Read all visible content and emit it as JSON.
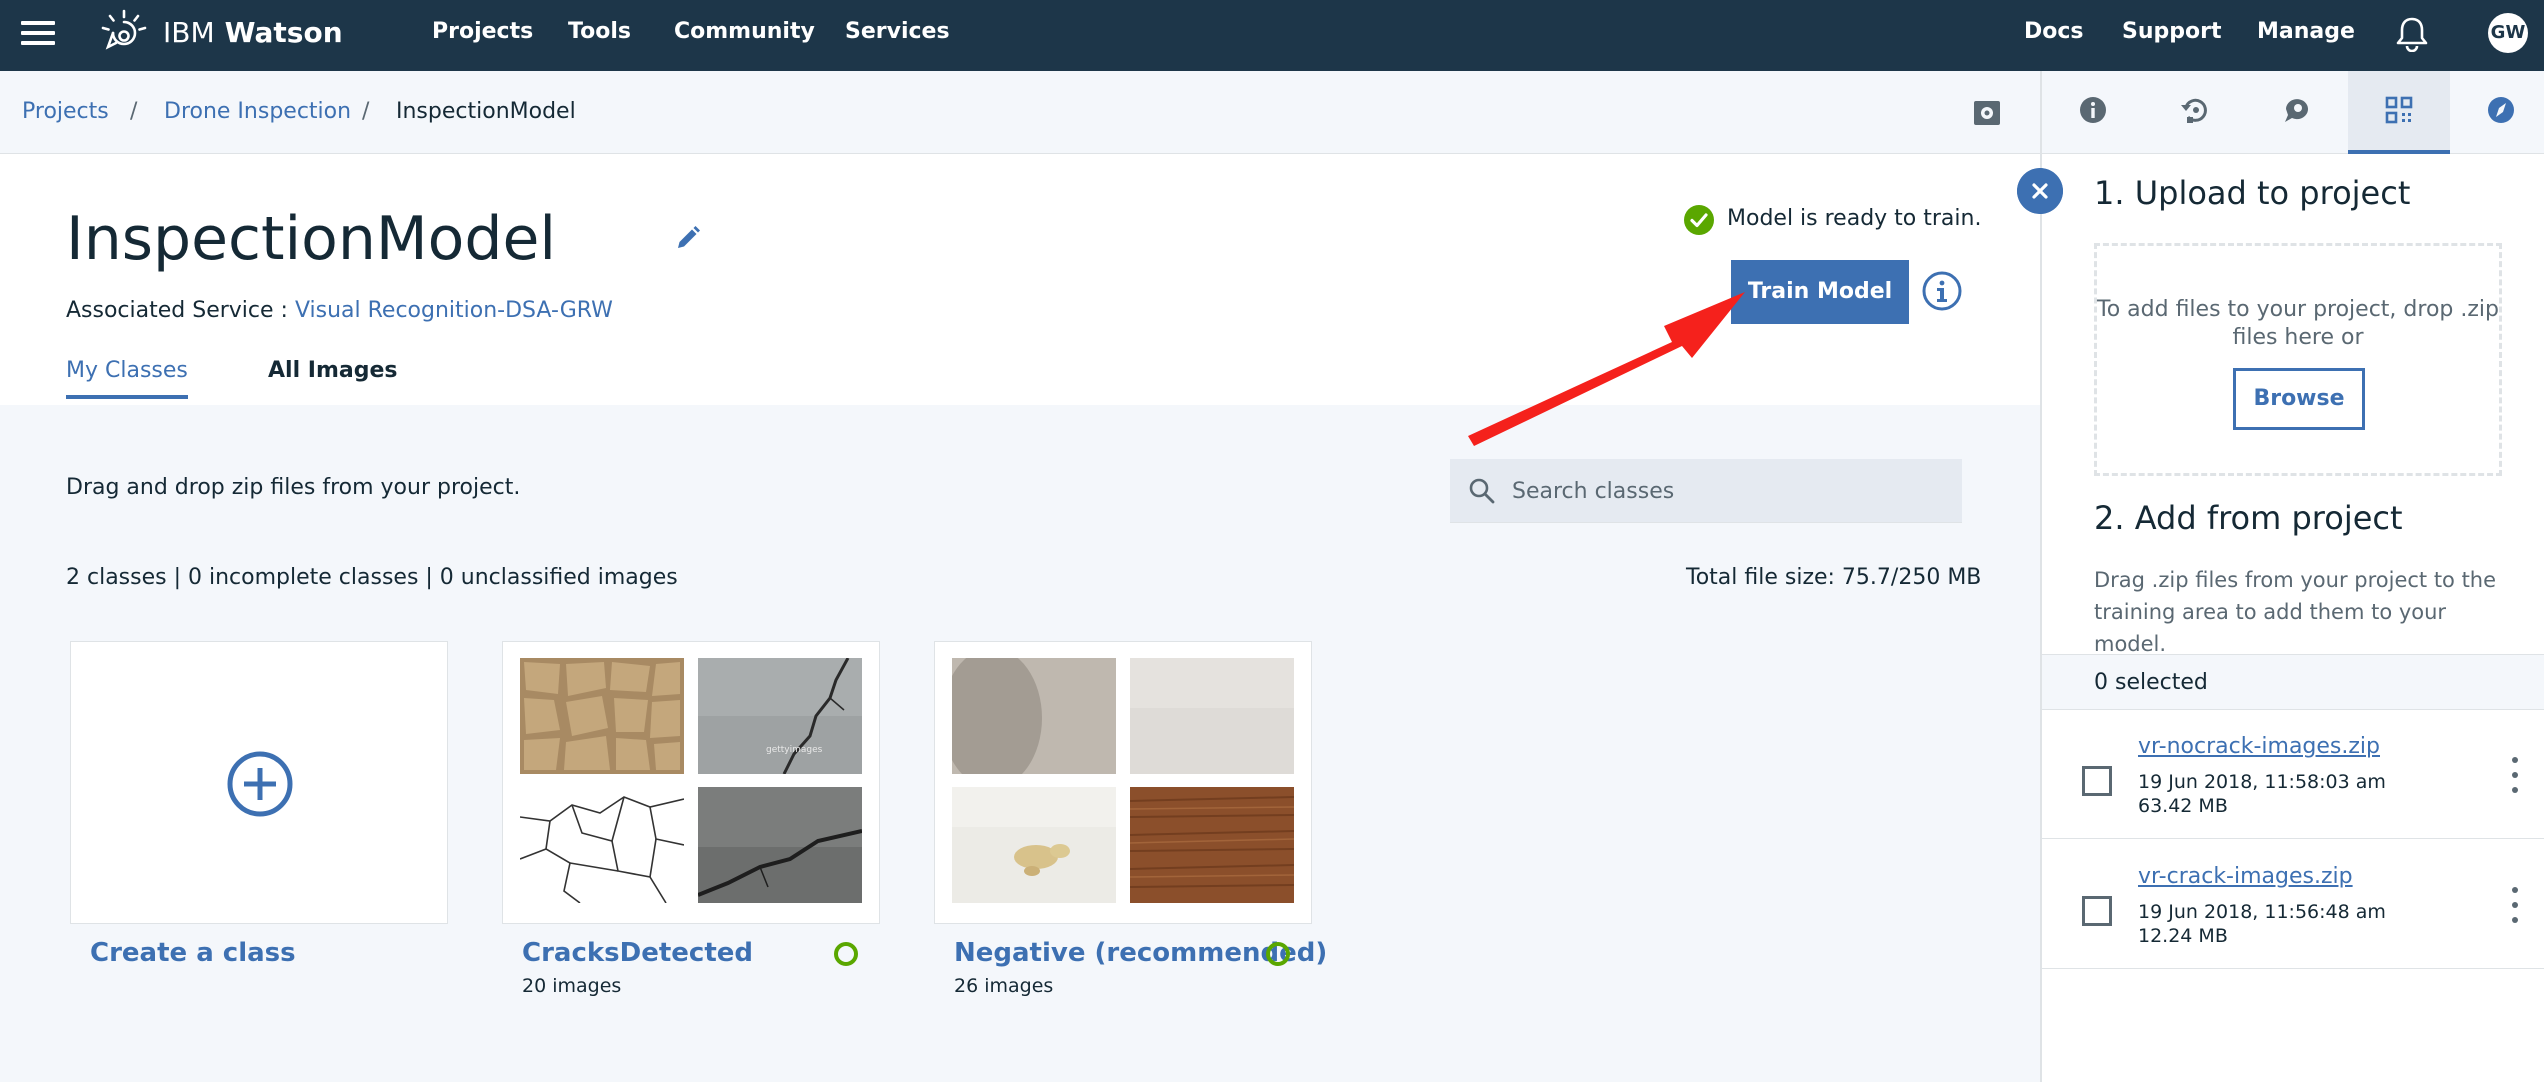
{
  "topnav": {
    "brand_ibm": "IBM",
    "brand_product": "Watson",
    "links": [
      "Projects",
      "Tools",
      "Community",
      "Services"
    ],
    "right_links": [
      "Docs",
      "Support",
      "Manage"
    ],
    "avatar_initials": "GW"
  },
  "breadcrumb": {
    "items": [
      "Projects",
      "Drone Inspection",
      "InspectionModel"
    ],
    "separator": "/"
  },
  "header": {
    "title": "InspectionModel",
    "assoc_label": "Associated Service : ",
    "assoc_service": "Visual Recognition-DSA-GRW",
    "status_text": "Model is ready to train.",
    "train_button": "Train Model"
  },
  "tabs": [
    {
      "label": "My Classes",
      "active": true
    },
    {
      "label": "All Images",
      "active": false
    }
  ],
  "content": {
    "drag_instructions": "Drag and drop zip files from your project.",
    "search_placeholder": "Search classes",
    "summary": "2 classes | 0 incomplete classes | 0 unclassified images",
    "total_file_size": "Total file size: 75.7/250 MB"
  },
  "classes": [
    {
      "title": "Create a class",
      "icon": "plus-circle-icon"
    },
    {
      "title": "CracksDetected",
      "count": "20 images",
      "thumbnails": [
        "dry-cracked-earth",
        "cracked-concrete",
        "crack-line-drawing",
        "cracked-stone"
      ]
    },
    {
      "title": "Negative (recommended)",
      "count": "26 images",
      "thumbnails": [
        "grey-wall",
        "white-wall",
        "stained-surface",
        "wood-grain"
      ]
    }
  ],
  "right_panel": {
    "tab_icons": [
      "info-icon",
      "refresh-icon",
      "comment-icon",
      "data-icon",
      "compass-icon"
    ],
    "active_tab": 3,
    "upload_title": "1. Upload to project",
    "dropzone_text": "To add files to your project, drop .zip files here or",
    "browse_button": "Browse",
    "add_title": "2. Add from project",
    "add_desc": "Drag .zip files from your project to the training area to add them to your model.",
    "selected_text": "0 selected",
    "files": [
      {
        "name": "vr-nocrack-images.zip",
        "date": "19 Jun 2018, 11:58:03 am",
        "size": "63.42 MB"
      },
      {
        "name": "vr-crack-images.zip",
        "date": "19 Jun 2018, 11:56:48 am",
        "size": "12.24 MB"
      }
    ]
  },
  "colors": {
    "nav_bg": "#1d3649",
    "accent": "#3d70b2",
    "success": "#5aa700",
    "annotation_arrow": "#f5211c",
    "page_bg": "#f4f7fb"
  }
}
